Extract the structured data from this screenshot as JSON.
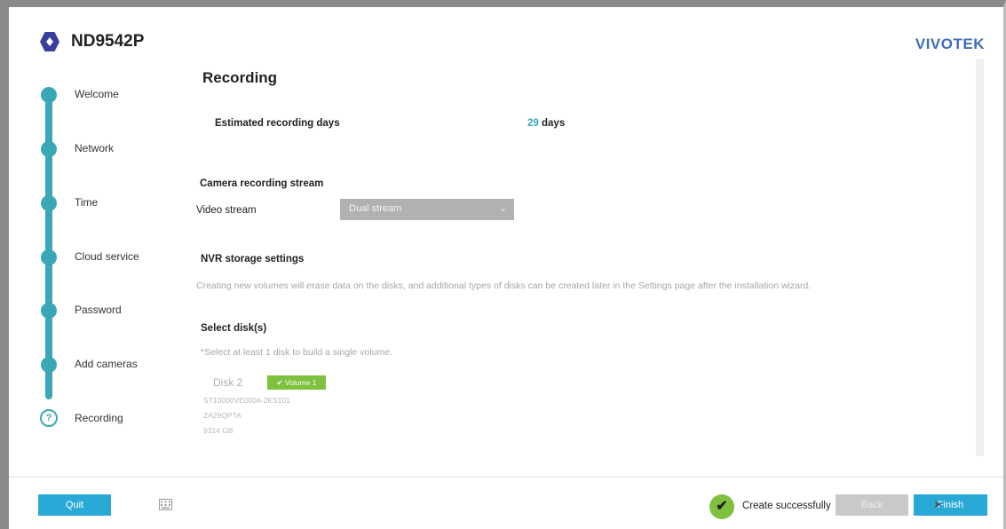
{
  "header": {
    "model": "ND9542P",
    "brand": "VIVOTEK"
  },
  "steps": [
    {
      "label": "Welcome",
      "state": "done"
    },
    {
      "label": "Network",
      "state": "done"
    },
    {
      "label": "Time",
      "state": "done"
    },
    {
      "label": "Cloud service",
      "state": "done"
    },
    {
      "label": "Password",
      "state": "done"
    },
    {
      "label": "Add cameras",
      "state": "done"
    },
    {
      "label": "Recording",
      "state": "current",
      "icon": "?"
    }
  ],
  "recording": {
    "title": "Recording",
    "estimated_label": "Estimated recording days",
    "estimated_value": "29",
    "estimated_unit": "days",
    "camera_stream_heading": "Camera recording stream",
    "video_stream_label": "Video stream",
    "video_stream_value": "Dual stream",
    "nvr_heading": "NVR storage settings",
    "nvr_note": "Creating new volumes will erase data on the disks, and additional types of disks can be created later in the Settings page after the installation wizard.",
    "select_disks_heading": "Select disk(s)",
    "select_disks_hint": "*Select at least 1 disk to build a single volume.",
    "disk": {
      "name": "Disk 2",
      "volume_badge": "✔ Volume 1",
      "model": "ST10000VE0004-2KS101",
      "serial": "ZA29QPTA",
      "size": "9314 GB"
    }
  },
  "footer": {
    "quit_label": "Quit",
    "status_check": "✔",
    "status_text": "Create successfully",
    "back_label": "Back",
    "finish_label": "Finish"
  },
  "colors": {
    "accent_teal": "#3aa7b7",
    "button_blue": "#29a9d6",
    "success_green": "#7dc13f",
    "brand_blue": "#3d6fb5"
  },
  "icons": {
    "logo": "hexagon-logo-icon",
    "keyboard": "keyboard-icon",
    "check": "check-icon",
    "help": "question-icon",
    "chevron": "chevron-down-icon"
  }
}
